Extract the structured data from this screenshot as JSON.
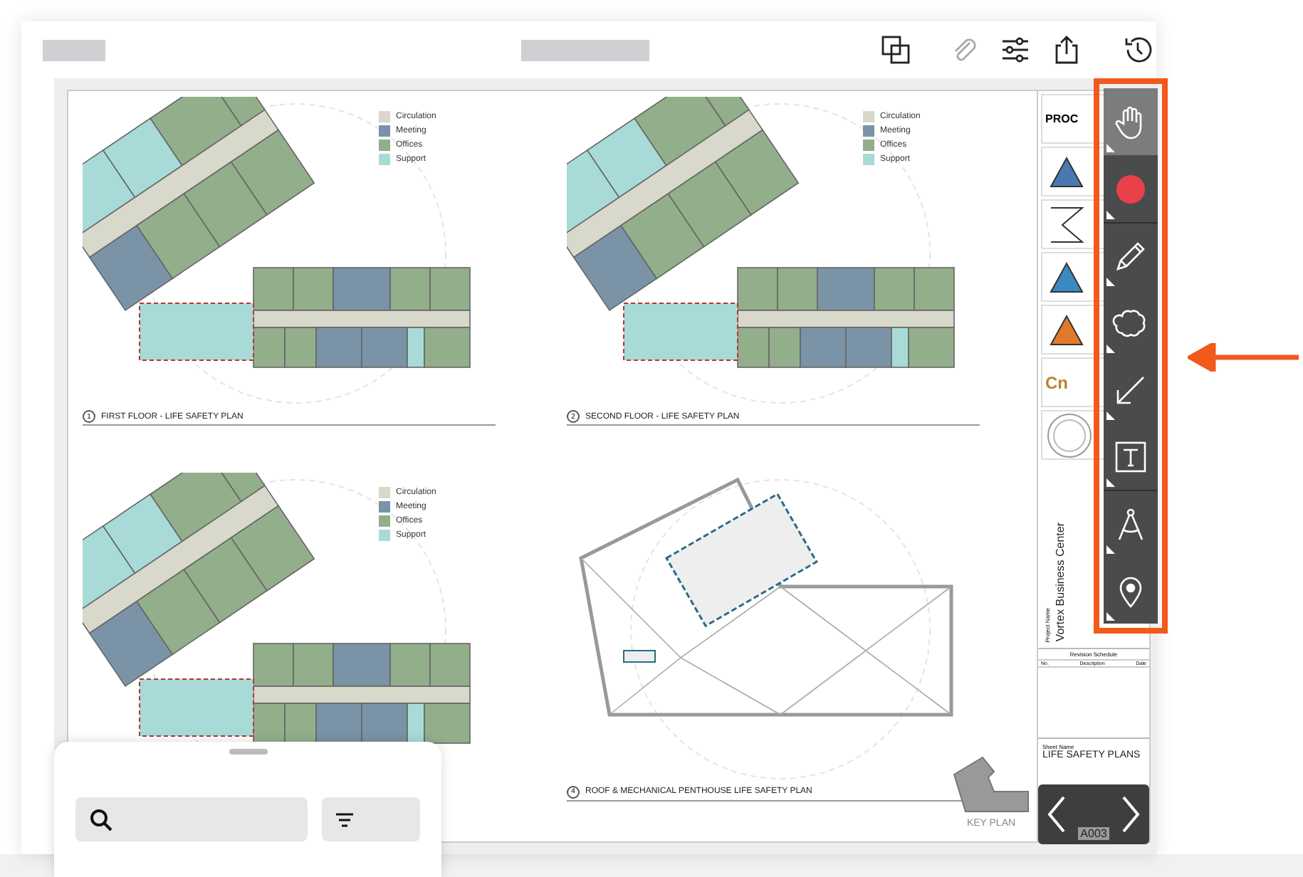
{
  "header": {
    "tools": [
      {
        "kind": "copy",
        "disabled": false
      },
      {
        "kind": "attach",
        "disabled": true
      },
      {
        "kind": "filters",
        "disabled": false
      },
      {
        "kind": "share",
        "disabled": false
      },
      {
        "kind": "history",
        "disabled": false
      }
    ]
  },
  "plans": [
    {
      "kind": "floor",
      "number": "1",
      "title": "FIRST FLOOR - LIFE SAFETY PLAN",
      "legend": [
        {
          "label": "Circulation",
          "color": "#d8d8cb"
        },
        {
          "label": "Meeting",
          "color": "#7b93a6"
        },
        {
          "label": "Offices",
          "color": "#93ae8b"
        },
        {
          "label": "Support",
          "color": "#a8dbd7"
        }
      ]
    },
    {
      "kind": "floor",
      "number": "2",
      "title": "SECOND FLOOR - LIFE SAFETY PLAN",
      "legend": [
        {
          "label": "Circulation",
          "color": "#d8d8cb"
        },
        {
          "label": "Meeting",
          "color": "#7b93a6"
        },
        {
          "label": "Offices",
          "color": "#93ae8b"
        },
        {
          "label": "Support",
          "color": "#a8dbd7"
        }
      ]
    },
    {
      "kind": "floor",
      "legend": [
        {
          "label": "Circulation",
          "color": "#d8d8cb"
        },
        {
          "label": "Meeting",
          "color": "#7b93a6"
        },
        {
          "label": "Offices",
          "color": "#93ae8b"
        },
        {
          "label": "Support",
          "color": "#a8dbd7"
        }
      ]
    },
    {
      "kind": "roof",
      "number": "4",
      "title": "ROOF & MECHANICAL PENTHOUSE LIFE SAFETY PLAN"
    }
  ],
  "title_block": {
    "logo_texts": [
      "PROC",
      "Cn"
    ],
    "project_label": "Project Name",
    "project_name": "Vortex Business Center",
    "revision_title": "Revision Schedule",
    "revision_columns": [
      "No.",
      "Description",
      "Date"
    ],
    "sheet_label": "Sheet Name",
    "sheet_name": "LIFE SAFETY PLANS"
  },
  "key_plan": {
    "label": "KEY PLAN"
  },
  "sheet_nav": {
    "sheet_number": "A003"
  },
  "toolbar": {
    "tools": [
      {
        "kind": "pan",
        "selected": true
      },
      {
        "kind": "record",
        "selected": false,
        "color": "#e8414a"
      },
      {
        "kind": "pencil",
        "selected": false
      },
      {
        "kind": "cloud",
        "selected": false
      },
      {
        "kind": "arrow",
        "selected": false
      },
      {
        "kind": "text",
        "selected": false
      },
      {
        "kind": "measure",
        "selected": false
      },
      {
        "kind": "pin",
        "selected": false
      }
    ]
  }
}
